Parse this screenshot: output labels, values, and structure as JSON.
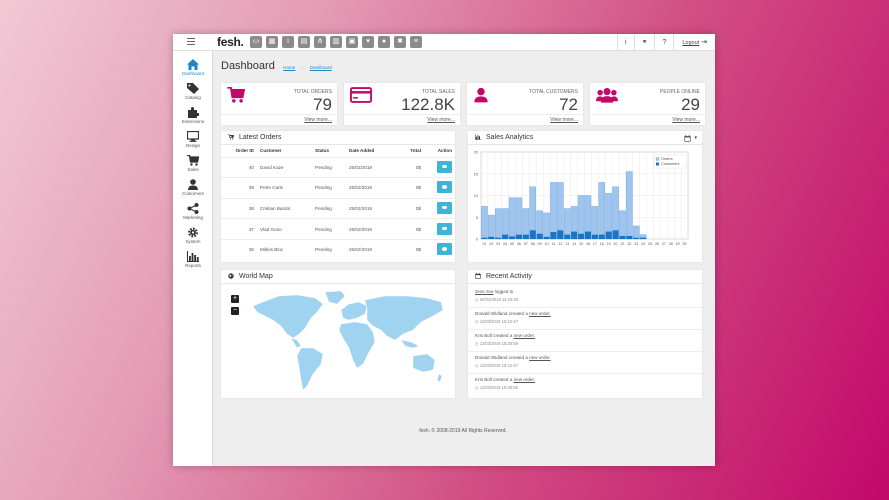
{
  "topbar": {
    "logo": "fesh.",
    "quick_icons": [
      "folder-icon",
      "grid-icon",
      "info-icon",
      "chat-icon",
      "sitemap-icon",
      "building-icon",
      "money-icon",
      "cart-icon",
      "users-icon",
      "cogs-icon",
      "list-icon"
    ],
    "info_label": "i",
    "link_label": "⚭",
    "help_label": "?",
    "logout_label": "Logout"
  },
  "sidebar": {
    "items": [
      {
        "label": "Dashboard",
        "icon": "home-icon",
        "active": true
      },
      {
        "label": "Catalog",
        "icon": "tags-icon"
      },
      {
        "label": "Extensions",
        "icon": "puzzle-icon"
      },
      {
        "label": "Design",
        "icon": "monitor-icon"
      },
      {
        "label": "Sales",
        "icon": "cart-icon"
      },
      {
        "label": "Customers",
        "icon": "user-icon"
      },
      {
        "label": "Marketing",
        "icon": "share-icon"
      },
      {
        "label": "System",
        "icon": "cog-icon"
      },
      {
        "label": "Reports",
        "icon": "barchart-icon"
      }
    ]
  },
  "page": {
    "title": "Dashboard",
    "breadcrumb": [
      "Home",
      "Dashboard"
    ],
    "breadcrumb_sep": "›"
  },
  "stats": [
    {
      "label": "TOTAL ORDERS",
      "value": "79",
      "link": "View more...",
      "icon": "cart-icon"
    },
    {
      "label": "TOTAL SALES",
      "value": "122.8K",
      "link": "View more...",
      "icon": "credit-card-icon"
    },
    {
      "label": "TOTAL CUSTOMERS",
      "value": "72",
      "link": "View more...",
      "icon": "user-icon"
    },
    {
      "label": "PEOPLE ONLINE",
      "value": "29",
      "link": "View more...",
      "icon": "users-icon"
    }
  ],
  "orders": {
    "title": "Latest Orders",
    "columns": [
      "Order ID",
      "Customer",
      "Status",
      "Date Added",
      "Total",
      "Action"
    ],
    "rows": [
      {
        "id": "40",
        "customer": "David Kaze",
        "status": "Pending",
        "date": "25/02/2019",
        "total": "0$"
      },
      {
        "id": "39",
        "customer": "Petre Caris",
        "status": "Pending",
        "date": "25/02/2019",
        "total": "0$"
      },
      {
        "id": "38",
        "customer": "Cristian Bardot",
        "status": "Pending",
        "date": "25/02/2019",
        "total": "0$"
      },
      {
        "id": "37",
        "customer": "Vlad Gurio",
        "status": "Pending",
        "date": "25/02/2019",
        "total": "0$"
      },
      {
        "id": "36",
        "customer": "Miklos Bloc",
        "status": "Pending",
        "date": "25/02/2019",
        "total": "0$"
      }
    ]
  },
  "analytics": {
    "title": "Sales Analytics",
    "calendar_icon": "calendar-icon"
  },
  "chart_data": {
    "type": "bar",
    "categories": [
      "01",
      "02",
      "03",
      "04",
      "05",
      "06",
      "07",
      "08",
      "09",
      "10",
      "11",
      "12",
      "13",
      "14",
      "15",
      "16",
      "17",
      "18",
      "19",
      "20",
      "21",
      "22",
      "23",
      "24",
      "25",
      "26",
      "27",
      "28",
      "29",
      "30"
    ],
    "series": [
      {
        "name": "Orders",
        "values": [
          7.5,
          5.5,
          7,
          7,
          9.5,
          9.5,
          7,
          12,
          6.5,
          6,
          13,
          13,
          7,
          7.5,
          10,
          10,
          7.5,
          13,
          10.5,
          12,
          6.5,
          15.5,
          3,
          1,
          0,
          0,
          0,
          0,
          0,
          0
        ]
      },
      {
        "name": "Customers",
        "values": [
          0.3,
          0.5,
          0.3,
          1,
          0.6,
          1,
          1,
          2,
          1.2,
          0.5,
          1.6,
          2,
          1,
          1.7,
          1.2,
          1.7,
          1,
          1,
          1.7,
          2,
          0.7,
          0.7,
          0.3,
          0.3,
          0,
          0,
          0,
          0,
          0,
          0
        ]
      }
    ],
    "ylim": [
      0,
      20
    ],
    "yticks": [
      "20",
      "15",
      "10",
      "5",
      "0"
    ],
    "grid": true,
    "legend": "top-right",
    "colors": {
      "orders": "#9fc5ee",
      "customers": "#1a74c5"
    }
  },
  "worldmap": {
    "title": "World Map",
    "zoom_in": "+",
    "zoom_out": "−"
  },
  "activity": {
    "title": "Recent Activity",
    "items": [
      {
        "subject": "zeze zee",
        "action": "logged in.",
        "link": "",
        "time": "02/02/2019 14:19:22"
      },
      {
        "subject": "Donald Widland",
        "action": "created a",
        "link": "new order.",
        "time": "11/03/2019 15:12:47"
      },
      {
        "subject": "Kris Boll",
        "action": "created a",
        "link": "new order.",
        "time": "11/03/2019 15:26:55"
      },
      {
        "subject": "Donald Widland",
        "action": "created a",
        "link": "new order.",
        "time": "11/03/2019 15:12:47"
      },
      {
        "subject": "Kris Boll",
        "action": "created a",
        "link": "new order.",
        "time": "11/03/2019 15:26:55"
      }
    ]
  },
  "footer": "fesh. © 2008-2019 All Rights Reserved.",
  "colors": {
    "accent": "#c2086a",
    "link": "#1e88c7",
    "button": "#3fb4d7"
  }
}
